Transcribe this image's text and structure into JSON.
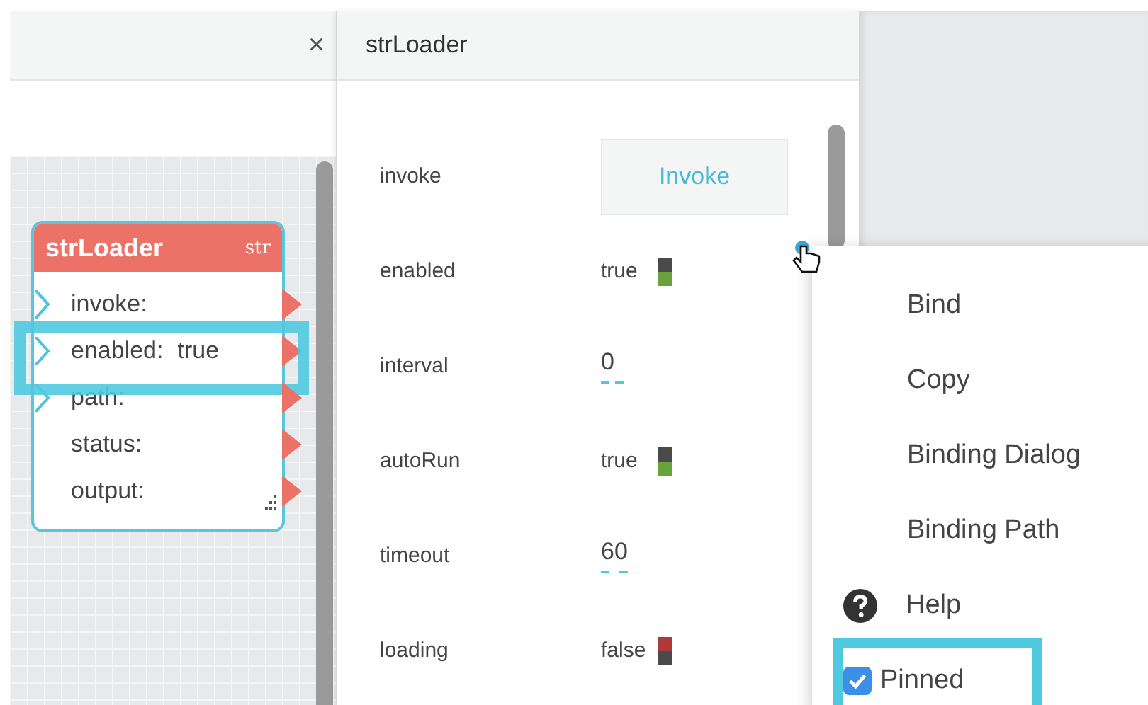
{
  "canvas_panel": {
    "close": "×",
    "node": {
      "title": "strLoader",
      "badge": "str",
      "ports": [
        {
          "label": "invoke:",
          "input": true,
          "highlighted": false
        },
        {
          "label": "enabled:",
          "value": "true",
          "input": true,
          "highlighted": true
        },
        {
          "label": "path:",
          "input": true,
          "highlighted": false
        },
        {
          "label": "status:",
          "input": false,
          "highlighted": false
        },
        {
          "label": "output:",
          "input": false,
          "highlighted": false
        }
      ]
    }
  },
  "inspector": {
    "title": "strLoader",
    "rows": [
      {
        "label": "invoke",
        "kind": "button",
        "value": "Invoke"
      },
      {
        "label": "enabled",
        "kind": "toggle",
        "value": "true",
        "on": true
      },
      {
        "label": "interval",
        "kind": "number",
        "value": "0"
      },
      {
        "label": "autoRun",
        "kind": "toggle",
        "value": "true",
        "on": true
      },
      {
        "label": "timeout",
        "kind": "number",
        "value": "60"
      },
      {
        "label": "loading",
        "kind": "toggle",
        "value": "false",
        "on": false
      }
    ]
  },
  "context_menu": {
    "items": [
      {
        "label": "Bind",
        "kind": "plain"
      },
      {
        "label": "Copy",
        "kind": "plain"
      },
      {
        "label": "Binding Dialog",
        "kind": "plain"
      },
      {
        "label": "Binding Path",
        "kind": "plain"
      },
      {
        "label": "Help",
        "kind": "help"
      },
      {
        "label": "Pinned",
        "kind": "checkbox",
        "checked": true,
        "highlighted": true
      }
    ]
  }
}
